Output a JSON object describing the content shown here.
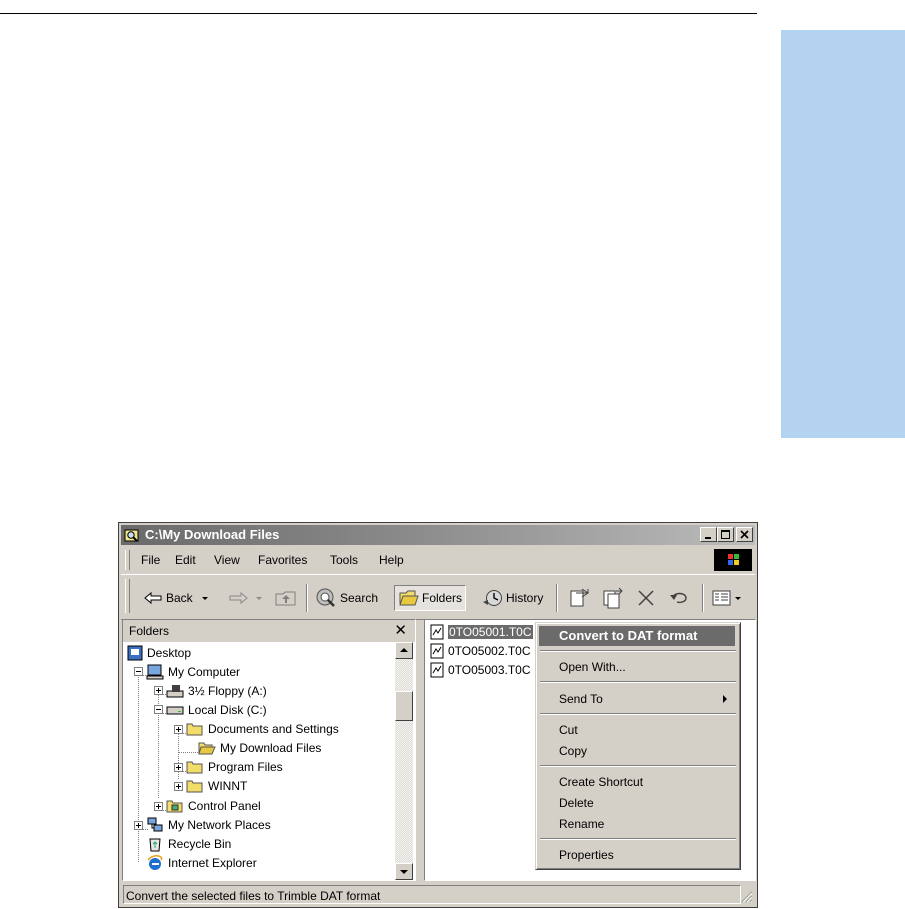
{
  "window": {
    "title": "C:\\My Download Files"
  },
  "menubar": {
    "items": [
      "File",
      "Edit",
      "View",
      "Favorites",
      "Tools",
      "Help"
    ]
  },
  "toolbar": {
    "back_label": "Back",
    "search_label": "Search",
    "folders_label": "Folders",
    "history_label": "History"
  },
  "folders_pane": {
    "header": "Folders",
    "close_glyph": "✕",
    "tree": [
      {
        "label": "Desktop"
      },
      {
        "label": "My Computer"
      },
      {
        "label": "3½ Floppy (A:)"
      },
      {
        "label": "Local Disk (C:)"
      },
      {
        "label": "Documents and Settings"
      },
      {
        "label": "My Download Files"
      },
      {
        "label": "Program Files"
      },
      {
        "label": "WINNT"
      },
      {
        "label": "Control Panel"
      },
      {
        "label": "My Network Places"
      },
      {
        "label": "Recycle Bin"
      },
      {
        "label": "Internet Explorer"
      }
    ]
  },
  "files": [
    {
      "name": "0TO05001.T0C"
    },
    {
      "name": "0TO05002.T0C"
    },
    {
      "name": "0TO05003.T0C"
    }
  ],
  "context_menu": {
    "items": [
      {
        "label": "Convert to DAT format"
      },
      {
        "label": "Open With..."
      },
      {
        "label": "Send To"
      },
      {
        "label": "Cut"
      },
      {
        "label": "Copy"
      },
      {
        "label": "Create Shortcut"
      },
      {
        "label": "Delete"
      },
      {
        "label": "Rename"
      },
      {
        "label": "Properties"
      }
    ]
  },
  "status_bar": {
    "text": "Convert the selected files to Trimble DAT format"
  },
  "colors": {
    "side_tab": "#b3d3f0",
    "selection": "#6b6b6b",
    "window_face": "#d4d0c8"
  }
}
